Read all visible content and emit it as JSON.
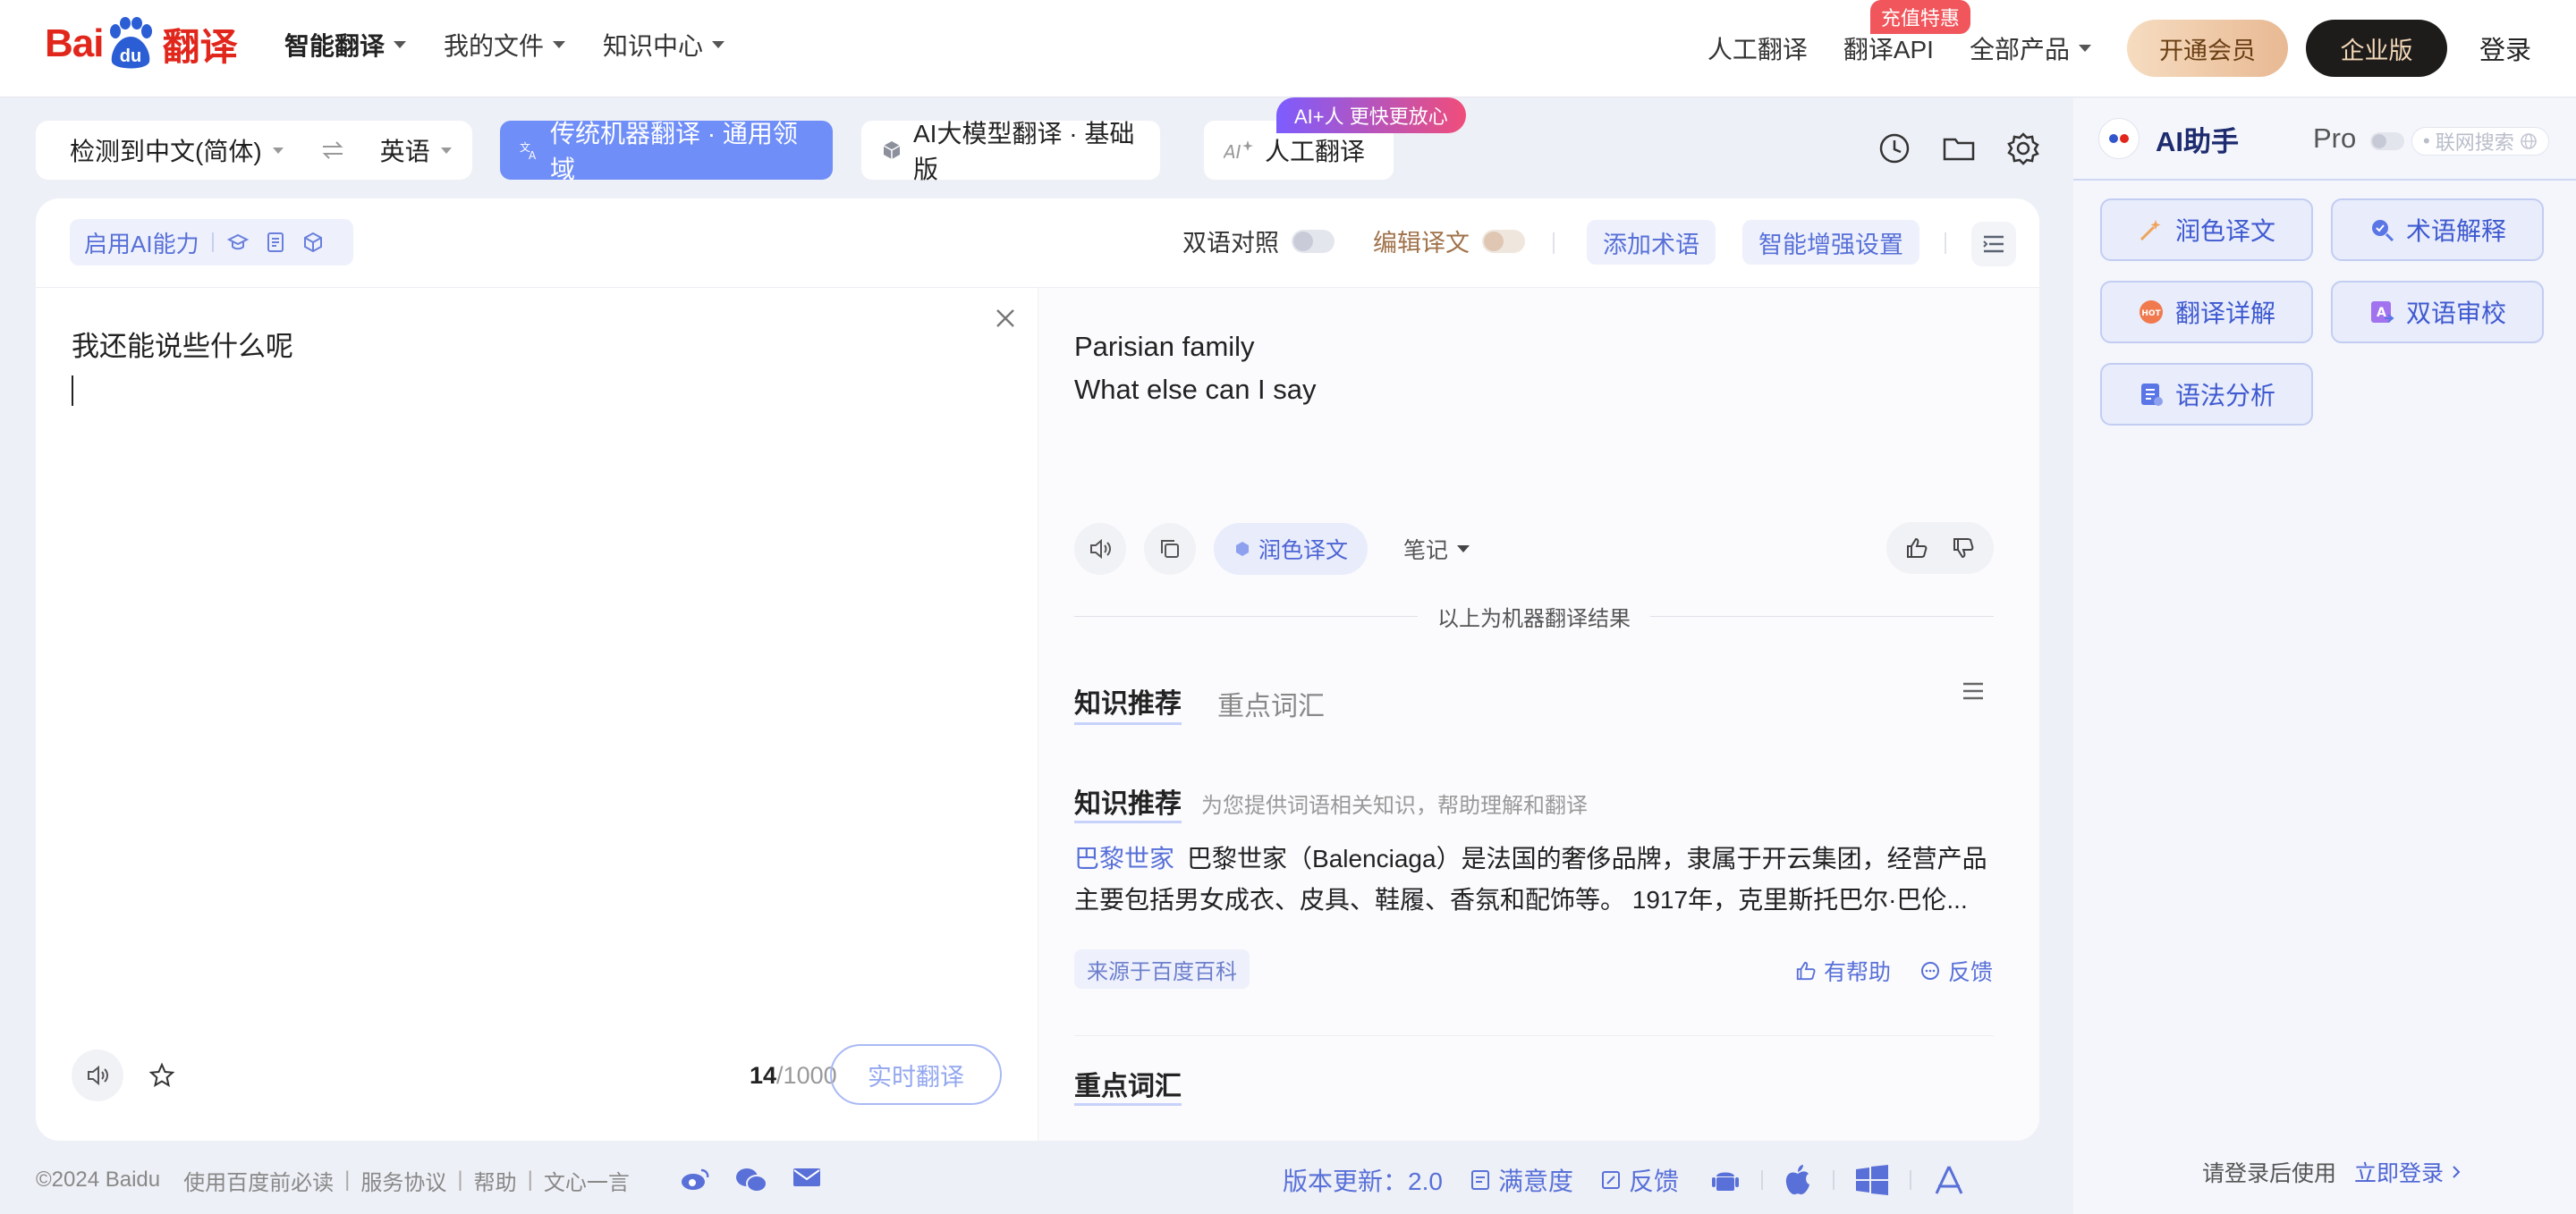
{
  "brand": {
    "logo_bai": "Bai",
    "logo_du": "du",
    "logo_fy": "翻译",
    "color": "#e1261c"
  },
  "nav": {
    "items": [
      "智能翻译",
      "我的文件",
      "知识中心"
    ]
  },
  "top_right": {
    "human": "人工翻译",
    "api": "翻译API",
    "api_badge": "充值特惠",
    "all_products": "全部产品",
    "vip": "开通会员",
    "enterprise": "企业版",
    "login": "登录"
  },
  "lang": {
    "source": "检测到中文(简体)",
    "swap_icon": "swap-icon",
    "target": "英语"
  },
  "modes": {
    "traditional": "传统机器翻译 · 通用领域",
    "llm": "AI大模型翻译 · 基础版",
    "human": "人工翻译",
    "human_badge": "AI+人 更快更放心"
  },
  "toolbar": {
    "ai_capability": "启用AI能力",
    "bilingual": "双语对照",
    "edit_translation": "编辑译文",
    "add_terms": "添加术语",
    "smart_settings": "智能增强设置"
  },
  "source": {
    "text": "我还能说些什么呢",
    "count_current": "14",
    "count_max": "/1000",
    "realtime": "实时翻译"
  },
  "target": {
    "lines": [
      "Parisian family",
      "What else can I say"
    ],
    "polish": "润色译文",
    "note": "笔记",
    "machine_note": "以上为机器翻译结果"
  },
  "knowledge": {
    "tabs": [
      "知识推荐",
      "重点词汇"
    ],
    "heading": "知识推荐",
    "subheading": "为您提供词语相关知识，帮助理解和翻译",
    "entry_link": "巴黎世家",
    "entry_line1": "巴黎世家（Balenciaga）是法国的奢侈品牌，隶属于开云集团，经营产品",
    "entry_line2": "主要包括男女成衣、皮具、鞋履、香氛和配饰等。 1917年，克里斯托巴尔·巴伦...",
    "source": "来源于百度百科",
    "helpful": "有帮助",
    "feedback": "反馈",
    "keywords_heading": "重点词汇"
  },
  "footer": {
    "copyright": "©2024 Baidu",
    "links": [
      "使用百度前必读",
      "服务协议",
      "帮助",
      "文心一言"
    ],
    "version": "版本更新：2.0",
    "satisfaction": "满意度",
    "feedback": "反馈"
  },
  "assistant": {
    "title": "AI助手",
    "pro": "Pro",
    "web_search": "联网搜索",
    "buttons": [
      "润色译文",
      "术语解释",
      "翻译详解",
      "双语审校",
      "语法分析"
    ],
    "login_hint": "请登录后使用",
    "login_now": "立即登录"
  },
  "colors": {
    "accent": "#6f8ef7",
    "link": "#5870d8",
    "brand_red": "#e1261c"
  }
}
